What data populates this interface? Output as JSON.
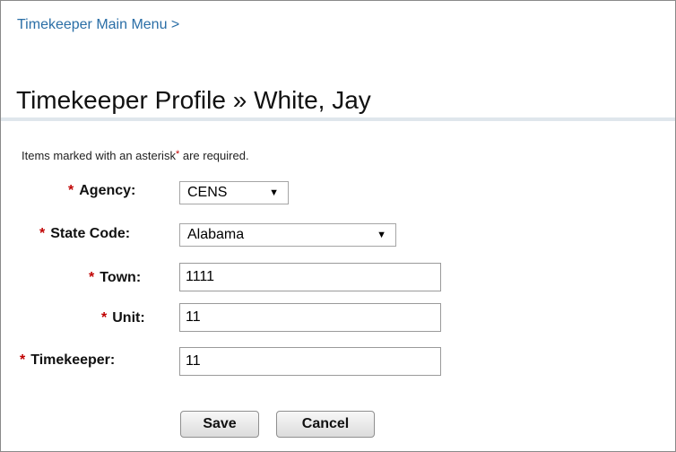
{
  "breadcrumb": {
    "label": "Timekeeper Main Menu >"
  },
  "page": {
    "title": "Timekeeper Profile » White, Jay"
  },
  "form": {
    "required_note_prefix": "Items marked with an asterisk",
    "required_note_asterisk": "*",
    "required_note_suffix": " are required.",
    "asterisk": "*",
    "agency": {
      "label": "Agency:",
      "value": "CENS"
    },
    "state_code": {
      "label": "State Code:",
      "value": "Alabama"
    },
    "town": {
      "label": "Town:",
      "value": "1111"
    },
    "unit": {
      "label": "Unit:",
      "value": "11"
    },
    "timekeeper": {
      "label": "Timekeeper:",
      "value": "11"
    },
    "dropdown_caret": "▼"
  },
  "actions": {
    "save_label": "Save",
    "cancel_label": "Cancel"
  },
  "colors": {
    "link": "#2a6ea6",
    "required": "#c00000",
    "rule": "#dfe6ec"
  }
}
